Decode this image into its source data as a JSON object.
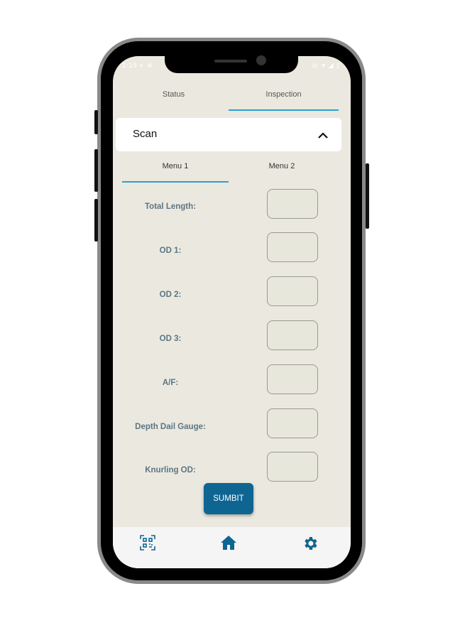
{
  "status_bar": {
    "time": "2:19",
    "left_icons": "◐ ⊕",
    "right_icons": "☏ ▾ ◢ ▯"
  },
  "top_tabs": [
    {
      "label": "Status",
      "active": false
    },
    {
      "label": "Inspection",
      "active": true
    }
  ],
  "scan_section": {
    "title": "Scan",
    "expanded": true
  },
  "sub_tabs": [
    {
      "label": "Menu 1",
      "active": true
    },
    {
      "label": "Menu 2",
      "active": false
    }
  ],
  "form_rows": [
    {
      "label": "Total Length:",
      "value": ""
    },
    {
      "label": "OD 1:",
      "value": ""
    },
    {
      "label": "OD 2:",
      "value": ""
    },
    {
      "label": "OD 3:",
      "value": ""
    },
    {
      "label": "A/F:",
      "value": ""
    },
    {
      "label": "Depth Dail Gauge:",
      "value": ""
    },
    {
      "label": "Knurling OD:",
      "value": ""
    }
  ],
  "submit_label": "SUMBIT",
  "bottom_nav": [
    {
      "icon": "qr-scan-icon"
    },
    {
      "icon": "home-icon"
    },
    {
      "icon": "settings-icon"
    }
  ],
  "colors": {
    "accent": "#2a9fd6",
    "primary": "#0e6592",
    "label": "#5c7585",
    "background": "#ebe9df"
  }
}
